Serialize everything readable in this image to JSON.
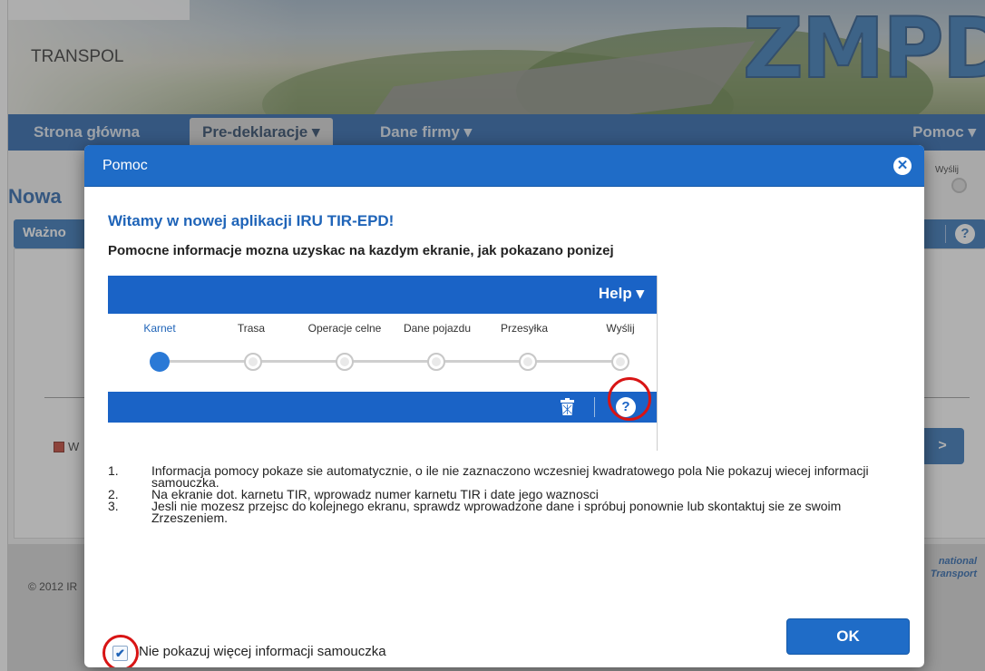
{
  "app": {
    "company_name": "TRANSPOL",
    "brand_logo": "ZMPD",
    "nav": {
      "home": "Strona główna",
      "pre_declarations": "Pre-deklaracje ▾",
      "company_data": "Dane firmy ▾",
      "help": "Pomoc ▾"
    },
    "page_title": "Nowa",
    "panel_title": "Ważno",
    "step_label": "Wyślij",
    "next_label": ">",
    "copyright": "© 2012 IR",
    "iru_text_1": "national",
    "iru_text_2": "Transport",
    "flag_text": "W"
  },
  "modal": {
    "title": "Pomoc",
    "close_icon": "close-icon",
    "welcome": "Witamy w nowej aplikacji IRU TIR-EPD!",
    "subtitle": "Pomocne informacje mozna uzyskac na kazdym ekranie, jak pokazano ponizej",
    "illustration": {
      "help_menu": "Help ▾",
      "steps": [
        "Karnet",
        "Trasa",
        "Operacje celne",
        "Dane pojazdu",
        "Przesyłka",
        "Wyślij"
      ],
      "active_step": 0,
      "help_icon": "?"
    },
    "instructions": [
      {
        "num": "1.",
        "text": "Informacja pomocy pokaze sie automatycznie, o ile nie zaznaczono wczesniej kwadratowego pola Nie pokazuj wiecej informacji samouczka."
      },
      {
        "num": "2.",
        "text": "Na ekranie dot. karnetu TIR, wprowadz numer karnetu TIR i date jego waznosci"
      },
      {
        "num": "3.",
        "text": "Jesli nie mozesz przejsc do kolejnego ekranu, sprawdz wprowadzone dane i spróbuj ponownie lub skontaktuj sie ze swoim Zrzeszeniem."
      }
    ],
    "checkbox": {
      "label": "Nie pokazuj więcej informacji samouczka",
      "checked": true,
      "check_mark": "✔"
    },
    "ok_label": "OK"
  },
  "colors": {
    "primary_blue": "#1f6cc7",
    "highlight_red": "#d81414"
  }
}
